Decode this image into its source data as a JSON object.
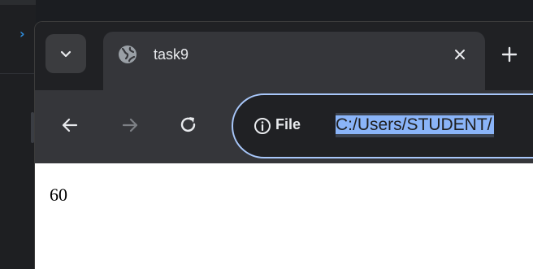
{
  "background_app": {
    "logo_icon": "vscode-logo-icon",
    "accent": "#2f8fe0"
  },
  "browser": {
    "tab_search_icon": "chevron-down-icon",
    "tab": {
      "title": "task9",
      "favicon": "globe-icon",
      "close_icon": "close-icon"
    },
    "new_tab_icon": "plus-icon",
    "toolbar": {
      "back_icon": "arrow-left-icon",
      "forward_icon": "arrow-right-icon",
      "reload_icon": "reload-icon"
    },
    "omnibox": {
      "info_icon": "info-circle-icon",
      "chip_label": "File",
      "url": "C:/Users/STUDENT/",
      "border_color": "#a8c7fa"
    }
  },
  "page": {
    "output_value": "60"
  }
}
